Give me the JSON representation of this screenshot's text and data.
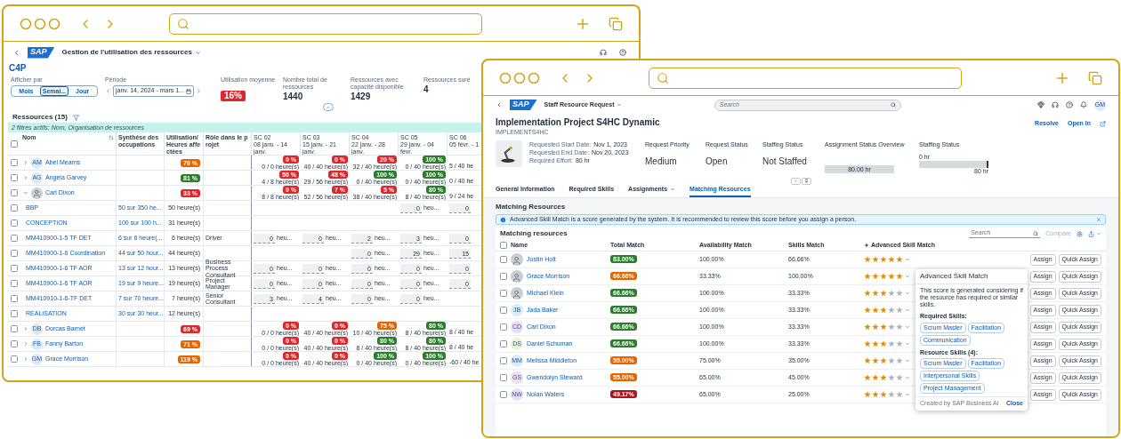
{
  "left_window": {
    "header": {
      "brand": "SAP",
      "app_title": "Gestion de l'utilisation des ressources"
    },
    "page_title": "C4P",
    "view_by": {
      "label": "Afficher par",
      "options": [
        {
          "label": "Mois",
          "selected": false
        },
        {
          "label": "Semai...",
          "selected": true
        },
        {
          "label": "Jour",
          "selected": false
        }
      ]
    },
    "period": {
      "label": "Période",
      "value": "janv. 14, 2024 - mars 1..."
    },
    "kpis": [
      {
        "kind": "badge",
        "label": "Utilisation moyenne",
        "value": "16%"
      },
      {
        "kind": "number",
        "label": "Nombre total de ressources",
        "value": "1440"
      },
      {
        "kind": "number",
        "label": "Ressources avec capacité disponible",
        "value": "1429"
      },
      {
        "kind": "number",
        "label": "Ressources suré",
        "value": "4"
      }
    ],
    "table": {
      "title": "Ressources (15)",
      "filter_info": "2 filtres actifs: Nom, Organisation de ressources",
      "all_checked": false,
      "columns": [
        "Nom",
        "Synthèse des occupations",
        "Utilisation/Heures affectées",
        "Rôle dans le projet"
      ],
      "weeks": [
        {
          "code": "SC 02",
          "range": "08 janv. - 14 janv."
        },
        {
          "code": "SC 03",
          "range": "15 janv. - 21 janv."
        },
        {
          "code": "SC 04",
          "range": "22 janv. - 28 janv."
        },
        {
          "code": "SC 05",
          "range": "29 janv. - 04 févr."
        },
        {
          "code": "SC 06",
          "range": "05 févr. - 1"
        }
      ],
      "rows": [
        {
          "kind": "person",
          "checked": false,
          "avatar": {
            "kind": "initials",
            "text": "AM"
          },
          "name": "Abel Mearns",
          "expanded": false,
          "utilization": {
            "text": "70 %",
            "color": "#e76500"
          },
          "weeks": [
            {
              "badge": "0 %",
              "color": "#e0262b",
              "hours": "0 / 0 heure(s)"
            },
            {
              "badge": "0 %",
              "color": "#e0262b",
              "hours": "40 / 40 heure(s)"
            },
            {
              "badge": "20 %",
              "color": "#e0262b",
              "hours": "32 / 40 heure(s)"
            },
            {
              "badge": "100 %",
              "color": "#2b7d2b",
              "hours": "0 / 40 heure(s)"
            },
            {
              "hours": "5 / 40 he"
            }
          ]
        },
        {
          "kind": "person",
          "checked": false,
          "avatar": {
            "kind": "initials",
            "text": "AG"
          },
          "name": "Angela Garvey",
          "expanded": false,
          "utilization": {
            "text": "81 %",
            "color": "#2b7d2b"
          },
          "weeks": [
            {
              "badge": "50 %",
              "color": "#e0262b",
              "hours": "4 / 8 heure(s)"
            },
            {
              "badge": "48 %",
              "color": "#e0262b",
              "hours": "29 / 56 heure(s)"
            },
            {
              "badge": "100 %",
              "color": "#2b7d2b",
              "hours": "0 / 40 heure(s)"
            },
            {
              "badge": "100 %",
              "color": "#2b7d2b",
              "hours": "0 / 40 heure(s)"
            },
            {
              "hours": "0 / 40 he"
            }
          ]
        },
        {
          "kind": "person",
          "checked": false,
          "avatar": {
            "kind": "photo"
          },
          "name": "Carl Dixon",
          "expanded": true,
          "utilization": {
            "text": "33 %",
            "color": "#e0262b"
          },
          "weeks": [
            {
              "badge": "0 %",
              "color": "#e0262b",
              "hours": "8 / 8 heure(s)"
            },
            {
              "badge": "7 %",
              "color": "#e0262b",
              "hours": "52 / 56 heure(s)"
            },
            {
              "badge": "5 %",
              "color": "#e0262b",
              "hours": "38 / 40 heure(s)"
            },
            {
              "badge": "80 %",
              "color": "#2b7d2b",
              "hours": "8 / 40 heure(s)"
            },
            {
              "hours": "9 / 24 he"
            }
          ]
        },
        {
          "kind": "assignment",
          "checked": false,
          "name": "BBP",
          "summary": "50 sur 350 he...",
          "hours": "50 heure(s)",
          "weeks": [
            {
              "kind": "blank"
            },
            {
              "kind": "blank"
            },
            {
              "kind": "blank"
            },
            {
              "kind": "input",
              "value": "0",
              "unit": "heu..."
            },
            {
              "kind": "input",
              "value": "0"
            }
          ]
        },
        {
          "kind": "assignment",
          "checked": false,
          "name": "CONCEPTION",
          "summary": "100 sur 100 h...",
          "hours": "31 heure(s)",
          "weeks": []
        },
        {
          "kind": "assignment",
          "checked": false,
          "name": "MM410900-1-5 TF DET",
          "summary": "6 sur 6 heure(...",
          "hours": "6 heure(s)",
          "role": "Driver",
          "weeks": [
            {
              "kind": "input",
              "value": "0",
              "unit": "heu..."
            },
            {
              "kind": "input",
              "value": "0",
              "unit": "heu..."
            },
            {
              "kind": "input",
              "value": "2",
              "unit": "heu..."
            },
            {
              "kind": "input",
              "value": "3",
              "unit": "heu..."
            },
            {
              "kind": "input",
              "value": "0"
            }
          ]
        },
        {
          "kind": "assignment",
          "checked": false,
          "name": "MM410900-1-6 Coordination",
          "summary": "44 sur 50 hour...",
          "hours": "44 heure(s)",
          "weeks": [
            {
              "kind": "blank"
            },
            {
              "kind": "blank"
            },
            {
              "kind": "input",
              "value": "0",
              "unit": "heu..."
            },
            {
              "kind": "input",
              "value": "29",
              "unit": "heu..."
            },
            {
              "kind": "input",
              "value": "15"
            }
          ]
        },
        {
          "kind": "assignment",
          "checked": false,
          "name": "MM410900-1-6 TF AOR",
          "summary": "13 sur 12 hour...",
          "hours": "13 heure(s)",
          "role": "Business Process Consultant",
          "weeks": [
            {
              "kind": "input",
              "value": "0",
              "unit": "heu..."
            },
            {
              "kind": "input",
              "value": "0",
              "unit": "heu..."
            },
            {
              "kind": "input",
              "value": "0",
              "unit": "heu..."
            },
            {
              "kind": "input",
              "value": "0",
              "unit": "heu..."
            },
            {
              "kind": "input",
              "value": "0"
            }
          ]
        },
        {
          "kind": "assignment",
          "checked": false,
          "name": "MM410900-1-6 TF AOR",
          "summary": "19 sur 9 heure...",
          "hours": "19 heure(s)",
          "role": "Project Manager",
          "weeks": [
            {
              "kind": "input",
              "value": "0",
              "unit": "heu..."
            },
            {
              "kind": "input",
              "value": "0",
              "unit": "heu..."
            },
            {
              "kind": "input",
              "value": "0",
              "unit": "heu..."
            },
            {
              "kind": "input",
              "value": "0",
              "unit": "heu..."
            },
            {
              "kind": "input",
              "value": "0"
            }
          ]
        },
        {
          "kind": "assignment",
          "checked": false,
          "name": "MM410910-1-6-TF DET",
          "summary": "7 sur 70 heure...",
          "hours": "7 heure(s)",
          "role": "Senior Consultant",
          "weeks": [
            {
              "kind": "input",
              "value": "3",
              "unit": "heu..."
            },
            {
              "kind": "input",
              "value": "4",
              "unit": "heu..."
            },
            {
              "kind": "input",
              "value": "0",
              "unit": "heu..."
            },
            {
              "kind": "input",
              "value": "0",
              "unit": "heu..."
            }
          ]
        },
        {
          "kind": "assignment",
          "checked": false,
          "name": "REALISATION",
          "summary": "30 sur 30 heur...",
          "hours": "12 heure(s)",
          "weeks": []
        },
        {
          "kind": "person",
          "checked": false,
          "avatar": {
            "kind": "initials",
            "text": "DB"
          },
          "name": "Dorcas Barnet",
          "expanded": false,
          "utilization": {
            "text": "69 %",
            "color": "#e0262b"
          },
          "weeks": [
            {
              "badge": "0 %",
              "color": "#e0262b",
              "hours": "0 / 0 heure(s)"
            },
            {
              "badge": "0 %",
              "color": "#e0262b",
              "hours": "40 / 40 heure(s)"
            },
            {
              "badge": "75 %",
              "color": "#e76500",
              "hours": "10 / 40 heure(s)"
            },
            {
              "badge": "80 %",
              "color": "#2b7d2b",
              "hours": "8 / 40 heure(s)"
            },
            {
              "hours": "8 / 40 he"
            }
          ]
        },
        {
          "kind": "person",
          "checked": false,
          "avatar": {
            "kind": "initials",
            "text": "FB"
          },
          "name": "Fanny Barton",
          "expanded": false,
          "utilization": {
            "text": "71 %",
            "color": "#e76500"
          },
          "weeks": [
            {
              "badge": "0 %",
              "color": "#e0262b",
              "hours": "0 / 0 heure(s)"
            },
            {
              "badge": "0 %",
              "color": "#e0262b",
              "hours": "40 / 40 heure(s)"
            },
            {
              "badge": "80 %",
              "color": "#2b7d2b",
              "hours": "8 / 40 heure(s)"
            },
            {
              "badge": "80 %",
              "color": "#2b7d2b",
              "hours": "8 / 40 heure(s)"
            },
            {
              "hours": "8 / 40 he"
            }
          ]
        },
        {
          "kind": "person",
          "checked": false,
          "avatar": {
            "kind": "initials",
            "text": "GM"
          },
          "name": "Grace Morrison",
          "expanded": false,
          "utilization": {
            "text": "119 %",
            "color": "#e76500"
          },
          "weeks": [
            {
              "badge": "0 %",
              "color": "#e0262b",
              "hours": "0 / 0 heure(s)"
            },
            {
              "badge": "0 %",
              "color": "#e0262b",
              "hours": "40 / 40 heure(s)"
            },
            {
              "badge": "100 %",
              "color": "#2b7d2b",
              "hours": "0 / 40 heure(s)"
            },
            {
              "badge": "100 %",
              "color": "#2b7d2b",
              "hours": "0 / 40 heure(s)"
            },
            {
              "hours": "-60 / 40 he"
            }
          ]
        }
      ]
    }
  },
  "right_window": {
    "header": {
      "brand": "SAP",
      "app_title": "Staff Resource Request",
      "search_placeholder": "Search",
      "avatar": "GM"
    },
    "title": "Implementation Project S4HC Dynamic",
    "subtitle": "IMPLEMENTS4HC",
    "actions": [
      "Resolve",
      "Open In"
    ],
    "dates": [
      {
        "label": "Requested Start Date:",
        "value": "Nov 1, 2023"
      },
      {
        "label": "Requested End Date:",
        "value": "Nov 20, 2023"
      },
      {
        "label": "Required Effort:",
        "value": "80 hr"
      }
    ],
    "attributes": [
      {
        "label": "Request Priority",
        "value": "Medium"
      },
      {
        "label": "Request Status",
        "value": "Open"
      },
      {
        "label": "Staffing Status",
        "value": "Not Staffed"
      }
    ],
    "assignment_overview": {
      "label": "Assignment Status Overview",
      "bar_label": "80.00 hr"
    },
    "staffing_status": {
      "label": "Staffing Status",
      "top_label": "0 hr",
      "bottom_label": "80 hr"
    },
    "tabs": [
      {
        "label": "General Information",
        "selected": false
      },
      {
        "label": "Required Skills",
        "selected": false
      },
      {
        "label": "Assignments",
        "selected": false,
        "menu": true
      },
      {
        "label": "Matching Resources",
        "selected": true
      }
    ],
    "section_title": "Matching Resources",
    "info": "Advanced Skill Match is a score generated by the system. It is recommended to review this score before you assign a person.",
    "table": {
      "title": "Matching resources",
      "search_placeholder": "Search",
      "compare": "Compare",
      "all_checked": false,
      "columns": [
        "Name",
        "Total Match",
        "Availability Match",
        "Skills Match",
        "Advanced Skill Match"
      ],
      "rows": [
        {
          "checked": false,
          "name": "Jostin Holt",
          "avatar": {
            "kind": "photo"
          },
          "total": {
            "text": "83.00%",
            "color": "#2b7d2b"
          },
          "availability": "100.00%",
          "skills": "66.66%",
          "stars": 5,
          "buttons": [
            "Assign",
            "Quick Assign"
          ]
        },
        {
          "checked": false,
          "name": "Grace Morrison",
          "avatar": {
            "kind": "photo"
          },
          "total": {
            "text": "66.66%",
            "color": "#e76500"
          },
          "availability": "33.33%",
          "skills": "100.00%",
          "stars": 5,
          "buttons": [
            "Assign",
            "Quick Assign"
          ]
        },
        {
          "checked": false,
          "name": "Michael Klein",
          "avatar": {
            "kind": "photo"
          },
          "total": {
            "text": "66.66%",
            "color": "#2b7d2b"
          },
          "availability": "100.00%",
          "skills": "33.33%",
          "stars": 3,
          "buttons": [
            "Assign",
            "Quick Assign"
          ]
        },
        {
          "checked": false,
          "name": "Jada Baker",
          "avatar": {
            "kind": "initials",
            "text": "JB",
            "color": "#d8ecfb"
          },
          "total": {
            "text": "66.66%",
            "color": "#2b7d2b"
          },
          "availability": "100.00%",
          "skills": "33.33%",
          "stars": 3,
          "buttons": [
            "Assign",
            "Quick Assign"
          ]
        },
        {
          "checked": false,
          "name": "Carl Dixon",
          "avatar": {
            "kind": "initials",
            "text": "CD",
            "color": "#eadcf5"
          },
          "total": {
            "text": "66.66%",
            "color": "#2b7d2b"
          },
          "availability": "100.00%",
          "skills": "33.33%",
          "stars": 3,
          "buttons": [
            "Assign",
            "Quick Assign"
          ]
        },
        {
          "checked": false,
          "name": "Daniel Schuman",
          "avatar": {
            "kind": "initials",
            "text": "DS",
            "color": "#eaf5cf"
          },
          "total": {
            "text": "66.66%",
            "color": "#2b7d2b"
          },
          "availability": "100.00%",
          "skills": "33.33%",
          "stars": 3,
          "buttons": [
            "Assign",
            "Quick Assign"
          ]
        },
        {
          "checked": false,
          "name": "Melissa Middleton",
          "avatar": {
            "kind": "initials",
            "text": "MM",
            "color": "#d8ecfb"
          },
          "total": {
            "text": "55.00%",
            "color": "#e76500"
          },
          "availability": "75.00%",
          "skills": "35.00%",
          "stars": 3,
          "buttons": [
            "Assign",
            "Quick Assign"
          ]
        },
        {
          "checked": false,
          "name": "Gwendolyn Steward",
          "avatar": {
            "kind": "initials",
            "text": "GS",
            "color": "#fbdcea"
          },
          "total": {
            "text": "55.00%",
            "color": "#e76500"
          },
          "availability": "65.00%",
          "skills": "45.00%",
          "stars": 3,
          "buttons": [
            "Assign",
            "Quick Assign"
          ]
        },
        {
          "checked": false,
          "name": "Nolan Waters",
          "avatar": {
            "kind": "initials",
            "text": "NW",
            "color": "#eadcf5"
          },
          "total": {
            "text": "49.17%",
            "color": "#b0141e"
          },
          "availability": "65.00%",
          "skills": "25.00%",
          "stars": 3,
          "buttons": [
            "Assign",
            "Quick Assign"
          ]
        }
      ]
    },
    "popover": {
      "title": "Advanced Skill Match",
      "text": "This score is generated considering if the resource has required or similar skills.",
      "required_label": "Required Skills:",
      "required": [
        "Scrum Master",
        "Facilitation",
        "Communication"
      ],
      "resource_label": "Resource Skills (4):",
      "resource": [
        "Scrum Master",
        "Facilitation",
        "Interpersonal Skills",
        "Project Management"
      ],
      "footer": "Created by SAP Business AI",
      "close": "Close"
    }
  }
}
